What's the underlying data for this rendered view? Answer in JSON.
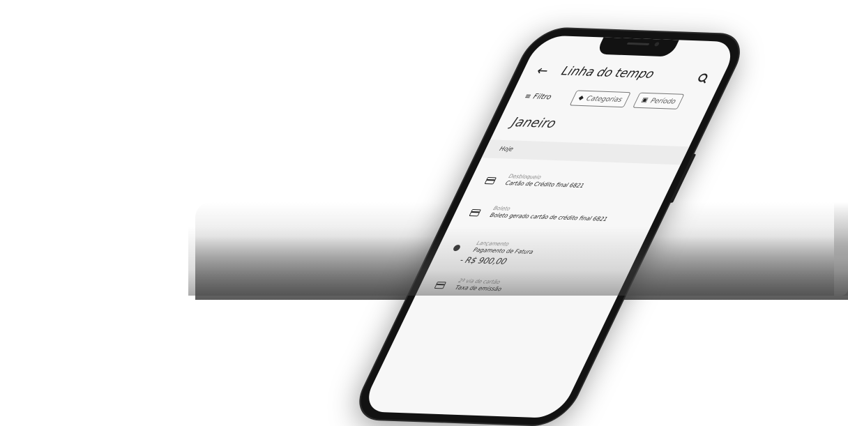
{
  "app": {
    "title": "Linha do tempo"
  },
  "icons": {
    "back": "arrow-left-icon",
    "search": "search-icon",
    "filter": "filter-lines-icon",
    "category": "tag-icon",
    "calendar": "calendar-icon",
    "card": "credit-card-icon",
    "payment": "circle-dot-icon"
  },
  "filters": {
    "label": "Filtro",
    "chips": [
      "Categorias",
      "Período"
    ]
  },
  "timeline": {
    "month": "Janeiro",
    "day": "Hoje",
    "items": [
      {
        "category": "Desbloqueio",
        "description": "Cartão de Crédito final 6821",
        "amount": ""
      },
      {
        "category": "Boleto",
        "description": "Boleto gerado cartão de crédito final 6821",
        "amount": ""
      },
      {
        "category": "Lançamento",
        "description": "Pagamento de Fatura",
        "amount": "- R$ 900,00"
      },
      {
        "category": "2ª via de cartão",
        "description": "Taxa de emissão",
        "amount": ""
      }
    ]
  }
}
